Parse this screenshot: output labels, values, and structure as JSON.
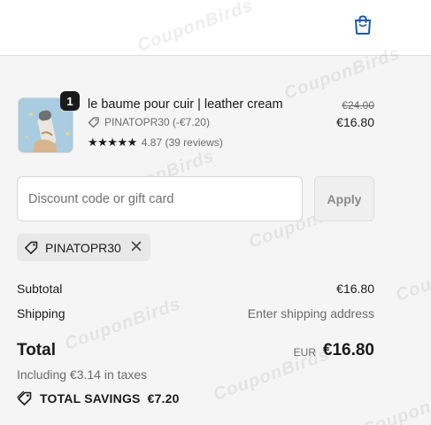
{
  "header": {
    "cart_icon": "shopping-bag-icon",
    "accent_color": "#1f5aa8"
  },
  "watermark_text": "CouponBirds",
  "line_item": {
    "quantity": "1",
    "name": "le baume pour cuir | leather cream",
    "discount": "PINATOPR30 (-€7.20)",
    "stars": "★★★★★",
    "rating": "4.87 (39 reviews)",
    "price_original": "€24.00",
    "price_current": "€16.80"
  },
  "discount_field": {
    "placeholder": "Discount code or gift card",
    "value": "",
    "apply_label": "Apply"
  },
  "applied_code": {
    "code": "PINATOPR30",
    "remove_icon": "close-icon"
  },
  "summary": {
    "subtotal_label": "Subtotal",
    "subtotal_value": "€16.80",
    "shipping_label": "Shipping",
    "shipping_value": "Enter shipping address",
    "total_label": "Total",
    "currency": "EUR",
    "total_value": "€16.80",
    "tax_note": "Including €3.14 in taxes",
    "savings_label": "TOTAL SAVINGS",
    "savings_value": "€7.20"
  }
}
